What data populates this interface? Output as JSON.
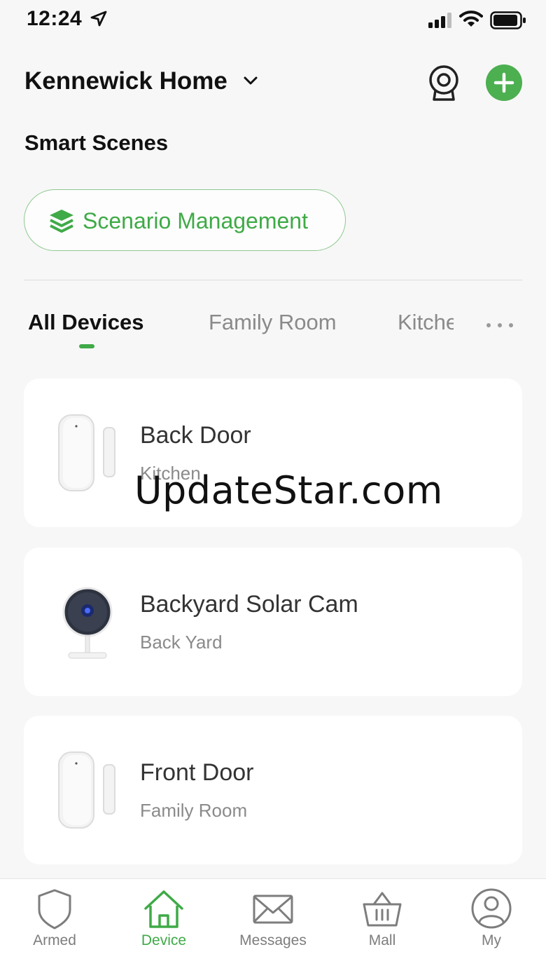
{
  "status_bar": {
    "time": "12:24"
  },
  "header": {
    "home_name": "Kennewick Home"
  },
  "smart_scenes": {
    "title": "Smart Scenes",
    "button_label": "Scenario Management"
  },
  "tabs": [
    {
      "label": "All Devices",
      "active": true
    },
    {
      "label": "Family Room",
      "active": false
    },
    {
      "label": "Kitche",
      "active": false
    }
  ],
  "devices": [
    {
      "name": "Back Door",
      "room": "Kitchen",
      "icon": "door-sensor-icon"
    },
    {
      "name": "Backyard Solar Cam",
      "room": "Back Yard",
      "icon": "solar-cam-icon"
    },
    {
      "name": "Front Door",
      "room": "Family Room",
      "icon": "door-sensor-icon"
    }
  ],
  "watermark": "UpdateStar.com",
  "bottom_nav": [
    {
      "label": "Armed",
      "icon": "shield-icon",
      "active": false
    },
    {
      "label": "Device",
      "icon": "home-icon",
      "active": true
    },
    {
      "label": "Messages",
      "icon": "envelope-icon",
      "active": false
    },
    {
      "label": "Mall",
      "icon": "basket-icon",
      "active": false
    },
    {
      "label": "My",
      "icon": "user-icon",
      "active": false
    }
  ],
  "colors": {
    "accent": "#3faa47",
    "add_button": "#4caf50",
    "background": "#f7f7f7"
  }
}
